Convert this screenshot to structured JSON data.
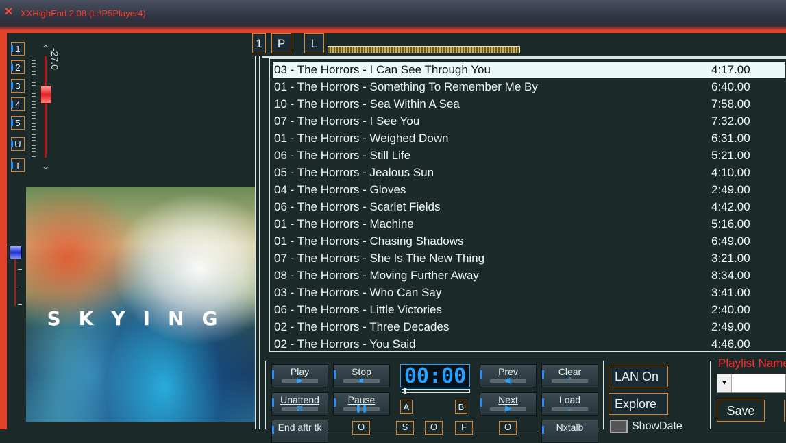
{
  "window": {
    "title": "XXHighEnd 2.08 (L:\\P5Player4)"
  },
  "left": {
    "num_buttons": [
      "1",
      "2",
      "3",
      "4",
      "5",
      "U",
      "I"
    ],
    "volume_label": "-27.0",
    "album_word": "SKYING"
  },
  "top": {
    "btn_1": "1",
    "btn_p": "P",
    "btn_l": "L"
  },
  "playlist": {
    "rows": [
      {
        "title": "03 - The Horrors - I Can See Through You",
        "dur": "4:17.00"
      },
      {
        "title": "01 - The Horrors - Something To Remember Me By",
        "dur": "6:40.00"
      },
      {
        "title": "10 - The Horrors - Sea Within A Sea",
        "dur": "7:58.00"
      },
      {
        "title": "07 - The Horrors - I See You",
        "dur": "7:32.00"
      },
      {
        "title": "01 - The Horrors - Weighed Down",
        "dur": "6:31.00"
      },
      {
        "title": "06 - The Horrors - Still Life",
        "dur": "5:21.00"
      },
      {
        "title": "05 - The Horrors - Jealous Sun",
        "dur": "4:10.00"
      },
      {
        "title": "04 - The Horrors - Gloves",
        "dur": "2:49.00"
      },
      {
        "title": "06 - The Horrors - Scarlet Fields",
        "dur": "4:42.00"
      },
      {
        "title": "01 - The Horrors - Machine",
        "dur": "5:16.00"
      },
      {
        "title": "01 - The Horrors - Chasing Shadows",
        "dur": "6:49.00"
      },
      {
        "title": "07 - The Horrors - She Is The New Thing",
        "dur": "3:21.00"
      },
      {
        "title": "08 - The Horrors - Moving Further Away",
        "dur": "8:34.00"
      },
      {
        "title": "03 - The Horrors - Who Can Say",
        "dur": "3:41.00"
      },
      {
        "title": "06 - The Horrors - Little Victories",
        "dur": "2:40.00"
      },
      {
        "title": "02 - The Horrors - Three Decades",
        "dur": "2:49.00"
      },
      {
        "title": "02 - The Horrors - You Said",
        "dur": "4:46.00"
      }
    ]
  },
  "controls": {
    "play": "Play",
    "stop": "Stop",
    "prev": "Prev",
    "clear": "Clear",
    "unattend": "Unattend",
    "pause": "Pause",
    "next": "Next",
    "load": "Load",
    "end_after": "End aftr tk",
    "nxtalb": "Nxtalb",
    "clock": "00:00",
    "a": "A",
    "b": "B",
    "row3_o1": "O",
    "row3_s": "S",
    "row3_o2": "O",
    "row3_f": "F",
    "row3_o3": "O"
  },
  "right": {
    "lan_on": "LAN On",
    "explore": "Explore",
    "show_date": "ShowDate",
    "playlist_name_label": "Playlist Name",
    "save": "Save"
  }
}
